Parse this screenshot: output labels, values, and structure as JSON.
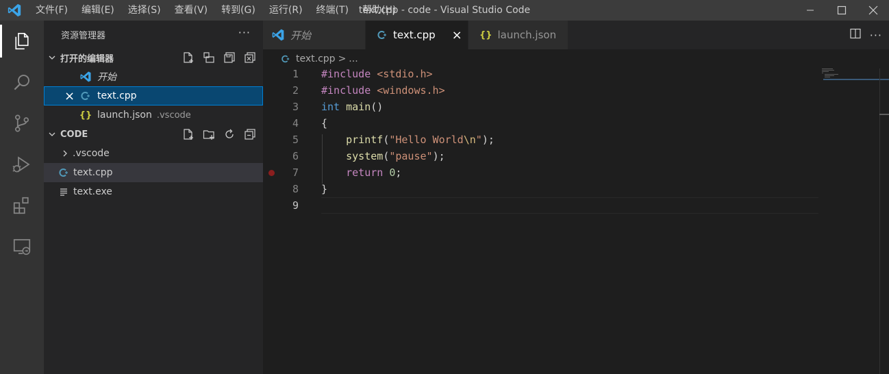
{
  "window": {
    "title": "text.cpp - code - Visual Studio Code",
    "menu": [
      "文件(F)",
      "编辑(E)",
      "选择(S)",
      "查看(V)",
      "转到(G)",
      "运行(R)",
      "终端(T)",
      "帮助(H)"
    ]
  },
  "activity_bar": {
    "icons": [
      "files-icon",
      "search-icon",
      "source-control-icon",
      "run-debug-icon",
      "extensions-icon",
      "remote-explorer-icon"
    ]
  },
  "sidebar": {
    "title": "资源管理器",
    "more": "···",
    "open_editors": {
      "label": "打开的编辑器",
      "items": [
        {
          "label": "开始",
          "icon": "vscode-logo-icon",
          "italic": true
        },
        {
          "label": "text.cpp",
          "icon": "cpp-file-icon",
          "close": "×"
        },
        {
          "label": "launch.json",
          "icon": "json-file-icon",
          "desc": ".vscode"
        }
      ]
    },
    "folder": {
      "label": "CODE",
      "items": [
        {
          "label": ".vscode",
          "icon": "chevron-right-icon"
        },
        {
          "label": "text.cpp",
          "icon": "cpp-file-icon"
        },
        {
          "label": "text.exe",
          "icon": "binary-file-icon"
        }
      ]
    }
  },
  "tabs": [
    {
      "label": "开始",
      "icon": "vscode-logo-icon"
    },
    {
      "label": "text.cpp",
      "icon": "cpp-file-icon",
      "close": "×"
    },
    {
      "label": "launch.json",
      "icon": "json-file-icon"
    }
  ],
  "breadcrumb": {
    "file": "text.cpp",
    "sep": ">",
    "rest": "..."
  },
  "code": {
    "line_numbers": [
      "1",
      "2",
      "3",
      "4",
      "5",
      "6",
      "7",
      "8",
      "9"
    ],
    "lines": [
      [
        {
          "t": "#include",
          "c": "pre"
        },
        {
          "t": " "
        },
        {
          "t": "<stdio.h>",
          "c": "inc"
        }
      ],
      [
        {
          "t": "#include",
          "c": "pre"
        },
        {
          "t": " "
        },
        {
          "t": "<windows.h>",
          "c": "inc"
        }
      ],
      [
        {
          "t": "int",
          "c": "kw"
        },
        {
          "t": " "
        },
        {
          "t": "main",
          "c": "fn"
        },
        {
          "t": "()"
        }
      ],
      [
        {
          "t": "{"
        }
      ],
      [
        {
          "t": "    "
        },
        {
          "t": "printf",
          "c": "fn"
        },
        {
          "t": "("
        },
        {
          "t": "\"Hello World",
          "c": "str"
        },
        {
          "t": "\\n",
          "c": "esc"
        },
        {
          "t": "\"",
          "c": "str"
        },
        {
          "t": ");"
        }
      ],
      [
        {
          "t": "    "
        },
        {
          "t": "system",
          "c": "fn"
        },
        {
          "t": "("
        },
        {
          "t": "\"pause\"",
          "c": "str"
        },
        {
          "t": ");"
        }
      ],
      [
        {
          "t": "    "
        },
        {
          "t": "return",
          "c": "ctl"
        },
        {
          "t": " "
        },
        {
          "t": "0",
          "c": "num"
        },
        {
          "t": ";"
        }
      ],
      [
        {
          "t": "}"
        }
      ],
      []
    ],
    "breakpoint_line": 7,
    "current_line": 9
  },
  "colors": {
    "accent": "#007acc",
    "selection": "#094771",
    "vscode_blue": "#0065a9",
    "cpp_icon": "#519aba",
    "json_icon": "#cbcb41"
  }
}
